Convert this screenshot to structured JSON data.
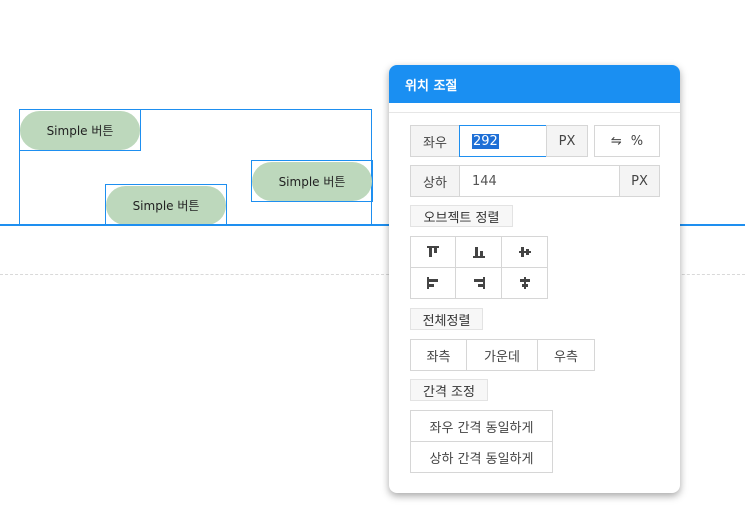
{
  "canvas": {
    "buttons": [
      {
        "label": "Simple 버튼"
      },
      {
        "label": "Simple 버튼"
      },
      {
        "label": "Simple 버튼"
      }
    ]
  },
  "panel": {
    "title": "위치 조절",
    "x_row": {
      "label": "좌우",
      "value": "292",
      "unit": "PX",
      "toggle_symbol": "⇋",
      "toggle_label": "%"
    },
    "y_row": {
      "label": "상하",
      "value": "144",
      "unit": "PX"
    },
    "object_align": {
      "label": "오브젝트 정렬",
      "icons": [
        "align-top-icon",
        "align-bottom-icon",
        "align-vertical-center-icon",
        "align-left-icon",
        "align-right-icon",
        "align-horizontal-center-icon"
      ]
    },
    "all_align": {
      "label": "전체정렬",
      "buttons": [
        "좌측",
        "가운데",
        "우측"
      ]
    },
    "spacing": {
      "label": "간격 조정",
      "buttons": [
        "좌우 간격 동일하게",
        "상하 간격 동일하게"
      ]
    }
  },
  "colors": {
    "accent": "#1a8ff2",
    "pill": "#bdd8bc"
  }
}
